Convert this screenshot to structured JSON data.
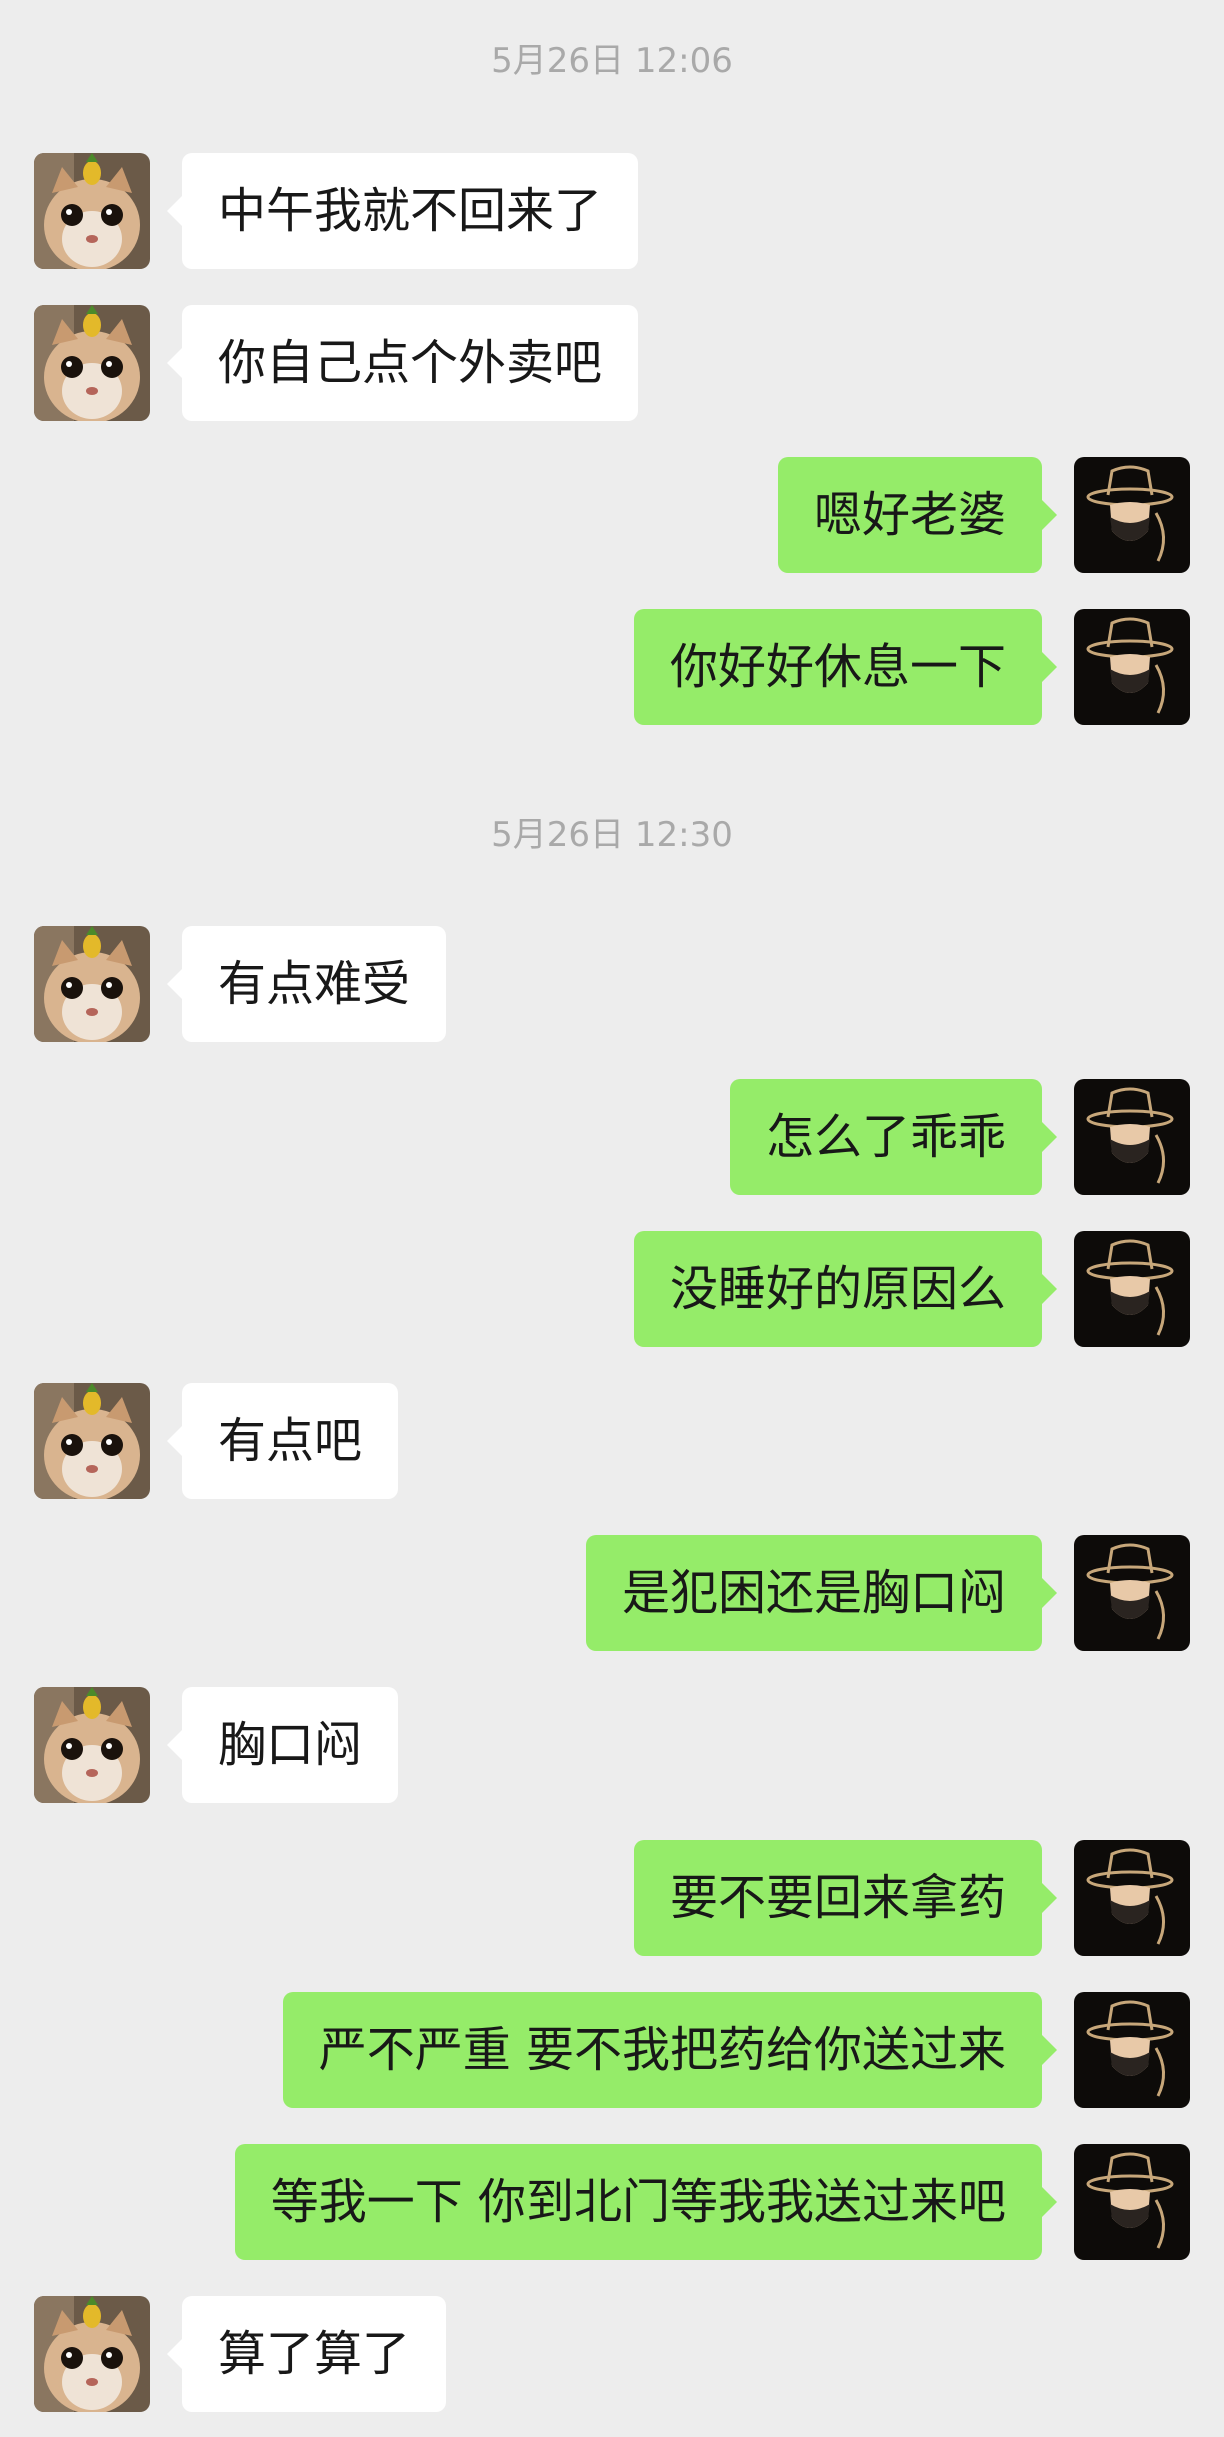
{
  "chat": {
    "colors": {
      "background": "#ededed",
      "incoming_bubble": "#ffffff",
      "outgoing_bubble": "#95ec69",
      "timestamp_text": "#a9a9a9"
    },
    "avatars": {
      "incoming": "cat-photo-avatar",
      "outgoing": "masked-man-in-hat-avatar"
    },
    "timestamps": [
      "5月26日 12:06",
      "5月26日 12:30"
    ],
    "messages": [
      {
        "side": "left",
        "text": "中午我就不回来了"
      },
      {
        "side": "left",
        "text": "你自己点个外卖吧"
      },
      {
        "side": "right",
        "text": "嗯好老婆"
      },
      {
        "side": "right",
        "text": "你好好休息一下"
      },
      {
        "side": "left",
        "text": "有点难受"
      },
      {
        "side": "right",
        "text": "怎么了乖乖"
      },
      {
        "side": "right",
        "text": "没睡好的原因么"
      },
      {
        "side": "left",
        "text": "有点吧"
      },
      {
        "side": "right",
        "text": "是犯困还是胸口闷"
      },
      {
        "side": "left",
        "text": "胸口闷"
      },
      {
        "side": "right",
        "text": "要不要回来拿药"
      },
      {
        "side": "right",
        "text": "严不严重 要不我把药给你送过来"
      },
      {
        "side": "right",
        "text": "等我一下 你到北门等我我送过来吧"
      },
      {
        "side": "left",
        "text": "算了算了"
      }
    ]
  }
}
